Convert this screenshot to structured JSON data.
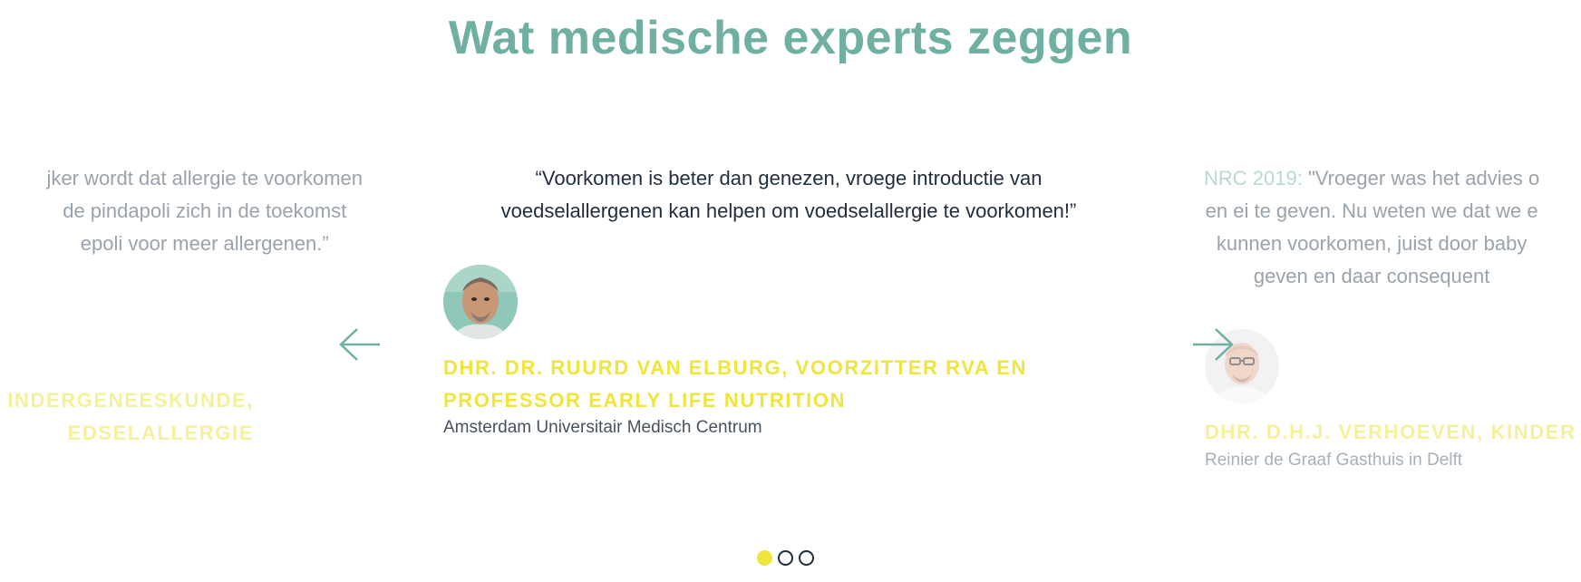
{
  "section": {
    "title": "Wat medische experts zeggen"
  },
  "slides": {
    "left": {
      "quote_lines": [
        "jker wordt dat allergie te voorkomen",
        "de pindapoli zich in de toekomst",
        "epoli voor meer allergenen.”"
      ],
      "name_lines": [
        "INDERGENEESKUNDE,",
        "EDSELALLERGIE"
      ]
    },
    "center": {
      "quote_lines": [
        "“Voorkomen is beter dan genezen, vroege introductie van",
        "voedselallergenen kan helpen om voedselallergie te voorkomen!”"
      ],
      "name_lines": [
        "DHR. DR. RUURD VAN ELBURG, VOORZITTER RVA EN",
        "PROFESSOR EARLY LIFE NUTRITION"
      ],
      "organization": "Amsterdam Universitair Medisch Centrum",
      "avatar_icon": "portrait-photo"
    },
    "right": {
      "quote_source": "NRC 2019:",
      "quote_lines": [
        "\"Vroeger was het advies o",
        "en ei te geven. Nu weten we dat we e",
        "kunnen voorkomen, juist door baby",
        "geven en daar consequent"
      ],
      "name": "DHR. D.H.J. VERHOEVEN, KINDER",
      "organization": "Reinier de Graaf Gasthuis in Delft",
      "avatar_icon": "portrait-photo"
    }
  },
  "controls": {
    "prev_icon": "arrow-left-icon",
    "next_icon": "arrow-right-icon",
    "dots": [
      {
        "active": true
      },
      {
        "active": false
      },
      {
        "active": false
      }
    ]
  },
  "colors": {
    "title": "#6fb0a2",
    "name_highlight": "#efe53b",
    "quote_text": "#1f2d3d",
    "faded_text": "#9aa3ab",
    "arrow": "#6fb0a2"
  }
}
